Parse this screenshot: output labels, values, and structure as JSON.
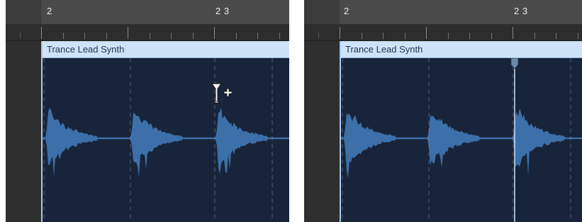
{
  "panels": [
    {
      "id": "before",
      "bar_labels": [
        "2",
        "2 3"
      ],
      "region": {
        "name": "Trance Lead Synth"
      },
      "cursor": {
        "icon": "marquee-pointer-plus-icon"
      }
    },
    {
      "id": "after",
      "bar_labels": [
        "2",
        "2 3"
      ],
      "region": {
        "name": "Trance Lead Synth"
      },
      "playhead": {
        "icon": "playhead-marker-icon"
      }
    }
  ],
  "colors": {
    "region_background": "#18243a",
    "region_header": "#cfe3f8",
    "region_title_text": "#1f3550",
    "waveform": "#3d6fa8",
    "playhead": "#c8dcf2"
  }
}
